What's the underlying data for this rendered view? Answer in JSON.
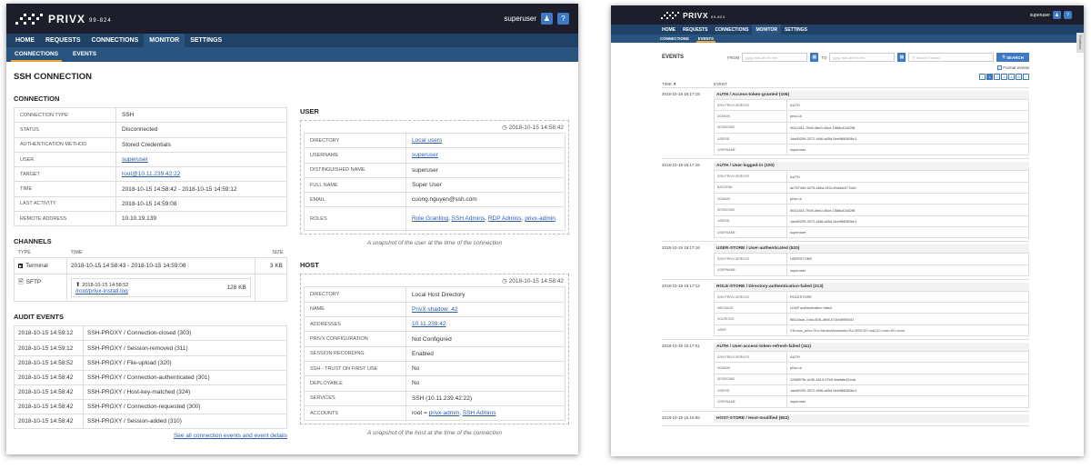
{
  "left": {
    "brand": "PRIVX",
    "version": "99-824",
    "username": "superuser",
    "nav": [
      "HOME",
      "REQUESTS",
      "CONNECTIONS",
      "MONITOR",
      "SETTINGS"
    ],
    "subnav": [
      "CONNECTIONS",
      "EVENTS"
    ],
    "page_title": "SSH CONNECTION",
    "connection_title": "CONNECTION",
    "connection": [
      {
        "k": "CONNECTION TYPE",
        "v": "SSH"
      },
      {
        "k": "STATUS",
        "v": "Disconnected"
      },
      {
        "k": "AUTHENTICATION METHOD",
        "v": "Stored Credentials"
      },
      {
        "k": "USER",
        "v": "superuser",
        "link": true
      },
      {
        "k": "TARGET",
        "v": "root@10.11.239.42:22",
        "link": true
      },
      {
        "k": "TIME",
        "v": "2018-10-15 14:58:42 - 2018-10-15 14:59:12"
      },
      {
        "k": "LAST ACTIVITY",
        "v": "2018-10-15 14:59:08"
      },
      {
        "k": "REMOTE ADDRESS",
        "v": "10.10.19.139"
      }
    ],
    "channels_title": "CHANNELS",
    "channels_headers": [
      "TYPE",
      "TIME",
      "SIZE"
    ],
    "channels": [
      {
        "type": "Terminal",
        "time": "2018-10-15 14:58:43 - 2018-10-15 14:59:08",
        "size": "3 KB"
      },
      {
        "type": "SFTP",
        "time": "2018-10-15 14:58:52",
        "file": "/root/privx-install.log",
        "size": "128 KB"
      }
    ],
    "audit_title": "AUDIT EVENTS",
    "audit": [
      {
        "t": "2018-10-15 14:59:12",
        "e": "SSH-PROXY / Connection-closed (303)"
      },
      {
        "t": "2018-10-15 14:59:12",
        "e": "SSH-PROXY / Session-removed (311)"
      },
      {
        "t": "2018-10-15 14:58:52",
        "e": "SSH-PROXY / File-upload (320)"
      },
      {
        "t": "2018-10-15 14:58:42",
        "e": "SSH-PROXY / Connection-authenticated (301)"
      },
      {
        "t": "2018-10-15 14:58:42",
        "e": "SSH-PROXY / Host-key-matched (324)"
      },
      {
        "t": "2018-10-15 14:58:42",
        "e": "SSH-PROXY / Connection-requested (300)"
      },
      {
        "t": "2018-10-15 14:58:42",
        "e": "SSH-PROXY / Session-added (310)"
      }
    ],
    "see_all": "See all connection events and event details",
    "user_title": "USER",
    "user_stamp": "2018-10-15 14:58:42",
    "user": [
      {
        "k": "DIRECTORY",
        "v": "Local users",
        "link": true
      },
      {
        "k": "USERNAME",
        "v": "superuser",
        "link": true
      },
      {
        "k": "DISTINGUISHED NAME",
        "v": "superuser"
      },
      {
        "k": "FULL NAME",
        "v": "Super User"
      },
      {
        "k": "EMAIL",
        "v": "cuong.nguyen@ssh.com"
      }
    ],
    "user_roles_label": "ROLES",
    "user_roles": [
      "Role Granting",
      "SSH Admins",
      "RDP Admins",
      "privx-admin"
    ],
    "user_snapshot": "A snapshot of the user at the time of the connection",
    "host_title": "HOST",
    "host_stamp": "2018-10-15 14:58:42",
    "host": [
      {
        "k": "DIRECTORY",
        "v": "Local Host Directory"
      },
      {
        "k": "NAME",
        "v": "PrivX shadow_42",
        "link": true
      },
      {
        "k": "ADDRESSES",
        "v": "10.11.239.42",
        "link": true
      },
      {
        "k": "PRIVX CONFIGURATION",
        "v": "Not Configured"
      },
      {
        "k": "SESSION RECORDING",
        "v": "Enabled"
      },
      {
        "k": "SSH - TRUST ON FIRST USE",
        "v": "No"
      },
      {
        "k": "DEPLOYABLE",
        "v": "No"
      },
      {
        "k": "SERVICES",
        "v": "SSH (10.11.239.42:22)"
      }
    ],
    "host_accounts_label": "ACCOUNTS",
    "host_accounts_prefix": "root = ",
    "host_accounts": [
      "privx-admin",
      "SSH Admins"
    ],
    "host_snapshot": "A snapshot of the host at the time of the connection"
  },
  "right": {
    "brand": "PRIVX",
    "version": "99-824",
    "username": "superuser",
    "nav": [
      "HOME",
      "REQUESTS",
      "CONNECTIONS",
      "MONITOR",
      "SETTINGS"
    ],
    "subnav": [
      "CONNECTIONS",
      "EVENTS"
    ],
    "events_title": "EVENTS",
    "from_label": "FROM",
    "to_label": "TO",
    "from_placeholder": "yyyy-mm-dd hh:mm",
    "to_placeholder": "yyyy-mm-dd hh:mm",
    "search_placeholder": "Search Events",
    "search_button": "SEARCH",
    "format_events": "Format events",
    "pages": [
      "‹",
      "1",
      "2",
      "3",
      "4",
      "5",
      "›"
    ],
    "col_time": "TIME ▼",
    "col_event": "EVENT",
    "feedback": "Feedback",
    "events": [
      {
        "time": "2018-10-19 16:17:18",
        "title": "AUTH / Access-token-granted (106)",
        "rows": [
          {
            "k": "SSH-PRIVX-SERVICE",
            "v": "AUTH"
          },
          {
            "k": "DOMAIN",
            "v": "privx-ui"
          },
          {
            "k": "SESSIONID",
            "v": "0f41c311-79d9-4bb0-45ce-1588c43d22f8"
          },
          {
            "k": "USERID",
            "v": "1da90209-2072-4f46-a65d-0be9880836c1"
          },
          {
            "k": "USERNAME",
            "v": "superuser"
          }
        ]
      },
      {
        "time": "2018-10-19 16:17:16",
        "title": "AUTH / User-logged-in (100)",
        "rows": [
          {
            "k": "SSH-PRIVX-SERVICE",
            "v": "AUTH"
          },
          {
            "k": "BACKEND",
            "v": "ae7674d0-b276-46ea-922c-fbdddc077dc0"
          },
          {
            "k": "DOMAIN",
            "v": "privx-ui"
          },
          {
            "k": "SESSIONID",
            "v": "0f41c311-79d9-4bb0-45ce-1588c43d22f8"
          },
          {
            "k": "USERID",
            "v": "1da90209-2072-4f46-a65d-0be9880836c1"
          },
          {
            "k": "USERNAME",
            "v": "superuser"
          }
        ]
      },
      {
        "time": "2018-10-19 16:17:16",
        "title": "USER-STORE / User-authenticated (520)",
        "rows": [
          {
            "k": "SSH-PRIVX-SERVICE",
            "v": "USERSTORE"
          },
          {
            "k": "USERNAME",
            "v": "superuser"
          }
        ]
      },
      {
        "time": "2018-10-19 16:17:12",
        "title": "ROLE-STORE / Directory-authentication-failed (213)",
        "rows": [
          {
            "k": "SSH-PRIVX-SERVICE",
            "v": "ROLESTORE"
          },
          {
            "k": "MESSAGE",
            "v": "LDAP authentication failed"
          },
          {
            "k": "SOURCEID",
            "v": "f5510a4e-7c6d-50f1-4fb8-074e0890051f"
          },
          {
            "k": "USER",
            "v": "CN=svc_privx,OU=ServiceAccounts,OU=SSH,DC=ssl,DC=com,DC=com"
          }
        ]
      },
      {
        "time": "2018-10-19 16:17:01",
        "title": "AUTH / User-access-token-refresh-failed (111)",
        "rows": [
          {
            "k": "SSH-PRIVX-SERVICE",
            "v": "AUTH"
          },
          {
            "k": "DOMAIN",
            "v": "privx-ui"
          },
          {
            "k": "SESSIONID",
            "v": "1288f07fb-cb30-4813-97b9-9aefafe42cda"
          },
          {
            "k": "USERID",
            "v": "1da90209-2072-4f46-a65d-0be9880836c1"
          },
          {
            "k": "USERNAME",
            "v": "superuser"
          }
        ]
      },
      {
        "time": "2018-10-19 16:16:55",
        "title": "HOST-STORE / Host-modified (802)",
        "rows": []
      }
    ]
  }
}
